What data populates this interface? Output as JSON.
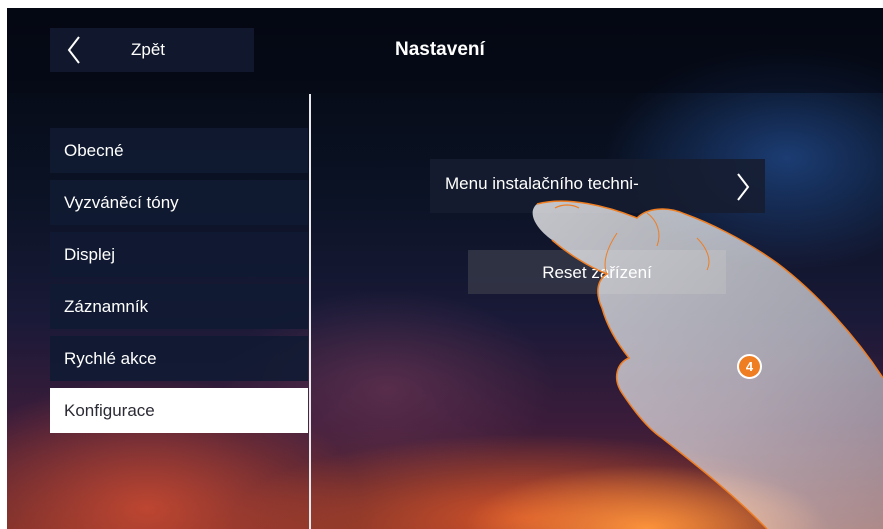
{
  "header": {
    "back_label": "Zpět",
    "title": "Nastavení"
  },
  "sidebar": {
    "items": [
      {
        "label": "Obecné"
      },
      {
        "label": "Vyzváněcí tóny"
      },
      {
        "label": "Displej"
      },
      {
        "label": "Záznamník"
      },
      {
        "label": "Rychlé akce"
      },
      {
        "label": "Konfigurace",
        "active": true
      }
    ]
  },
  "main": {
    "installer_menu_label": "Menu instalačního techni-",
    "reset_label": "Reset zařízení"
  },
  "annotation": {
    "step_number": "4",
    "badge_color": "#ef7d22"
  }
}
